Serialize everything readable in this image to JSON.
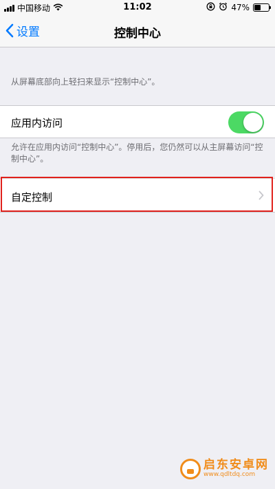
{
  "status_bar": {
    "carrier": "中国移动",
    "time": "11:02",
    "battery_percent": "47%",
    "battery_level": 0.47,
    "signal_icon": "signal-bars-icon",
    "wifi_icon": "wifi-icon",
    "rotation_lock_icon": "rotation-lock-icon",
    "alarm_icon": "alarm-icon"
  },
  "nav": {
    "back_label": "设置",
    "title": "控制中心"
  },
  "hint_top": "从屏幕底部向上轻扫来显示“控制中心”。",
  "access_within_apps": {
    "label": "应用内访问",
    "enabled": true,
    "toggle_color": "#4cd964"
  },
  "hint_access": "允许在应用内访问“控制中心”。停用后，您仍然可以从主屏幕访问“控制中心”。",
  "customize": {
    "label": "自定控制",
    "highlight_color": "#e0201b"
  },
  "accent_color": "#007aff",
  "watermark": {
    "title": "启东安卓网",
    "url": "www.qdltdq.com"
  }
}
